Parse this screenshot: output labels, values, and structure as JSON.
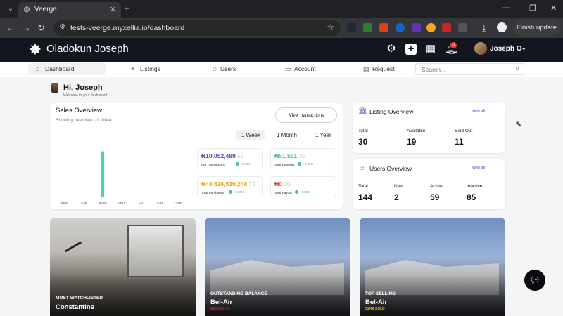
{
  "browser": {
    "tab_title": "Veerge",
    "url": "tests-veerge.myxellia.io/dashboard",
    "finish_update": "Finish update"
  },
  "app": {
    "brand": "Oladokun Joseph",
    "notification_count": "12",
    "user_name": "Joseph O"
  },
  "nav": {
    "items": [
      {
        "label": "Dashboard",
        "icon": "home-icon"
      },
      {
        "label": "Listings",
        "icon": "location-pin-icon"
      },
      {
        "label": "Users",
        "icon": "user-icon"
      },
      {
        "label": "Account",
        "icon": "wallet-icon"
      },
      {
        "label": "Request",
        "icon": "calendar-icon"
      }
    ],
    "search_placeholder": "Search..."
  },
  "greeting": {
    "title": "Hi, Joseph",
    "subtitle": "Welcome to your dashboard"
  },
  "sales": {
    "title": "Sales Overview",
    "subtitle": "Showing overview - 1 Week",
    "view_transactions": "View transactions",
    "periods": [
      "1 Week",
      "1 Month",
      "1 Year"
    ],
    "stats": [
      {
        "value": "₦10,052,489",
        "decimals": ".55",
        "label": "Net Transactions",
        "change": "+0.00%",
        "color": "#4b47d1"
      },
      {
        "value": "₦51,551",
        "decimals": ".35",
        "label": "Total Deposits",
        "change": "+0.00%",
        "color": "#3cc48a"
      },
      {
        "value": "₦49,626,539,248",
        "decimals": ".72",
        "label": "Total Purchases",
        "change": "+0.00%",
        "color": "#f0a020"
      },
      {
        "value": "₦0",
        "decimals": ".00",
        "label": "Total Payout",
        "change": "+0.00%",
        "color": "#e53935"
      }
    ]
  },
  "chart_data": {
    "type": "bar",
    "categories": [
      "Mon",
      "Tue",
      "Wed",
      "Thur",
      "Fri",
      "Sat",
      "Sun"
    ],
    "values": [
      0,
      0,
      1,
      0,
      0,
      0,
      0
    ],
    "ylim": [
      0,
      1.1
    ],
    "bar_color": "#3fdc9a"
  },
  "listing_overview": {
    "title": "Listing Overview",
    "view_all": "view all",
    "stats": [
      {
        "label": "Total",
        "value": "30"
      },
      {
        "label": "Available",
        "value": "19"
      },
      {
        "label": "Sold Out",
        "value": "11"
      }
    ]
  },
  "users_overview": {
    "title": "Users Overview",
    "view_all": "view all",
    "stats": [
      {
        "label": "Total",
        "value": "144"
      },
      {
        "label": "New",
        "value": "2"
      },
      {
        "label": "Active",
        "value": "59"
      },
      {
        "label": "Inactive",
        "value": "85"
      }
    ]
  },
  "properties": [
    {
      "caption": "MOST WATCHLISTED",
      "name": "Constantine",
      "extra": ""
    },
    {
      "caption": "OUTSTANDING BALANCE",
      "name": "Bel-Air",
      "extra": "₦000000.42",
      "extra_color": "#e53935"
    },
    {
      "caption": "TOP SELLING",
      "name": "Bel-Air",
      "extra": "31/46 SOLD",
      "extra_color": "#f0c419"
    }
  ]
}
